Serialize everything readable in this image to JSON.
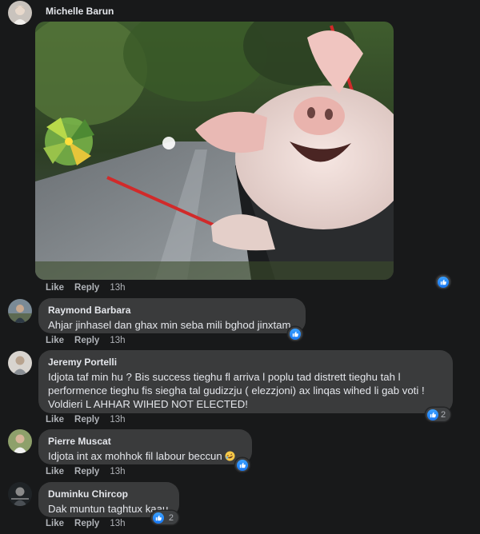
{
  "comments": [
    {
      "author": "Michelle Barun",
      "text": "",
      "actions": [
        "Like",
        "Reply"
      ],
      "time": "13h",
      "reactions": {
        "icons": [
          "like-icon"
        ],
        "count": ""
      }
    },
    {
      "author": "Raymond Barbara",
      "text": "Ahjar jinhasel dan ghax min seba mili bghod jinxtam",
      "actions": [
        "Like",
        "Reply"
      ],
      "time": "13h",
      "reactions": {
        "icons": [
          "like-icon"
        ],
        "count": ""
      }
    },
    {
      "author": "Jeremy Portelli",
      "text_lines": [
        "Idjota taf min hu ? Bis success tieghu fl arriva l poplu tad distrett tieghu tah l",
        "performence tieghu fis siegha tal gudizzju ( elezzjoni) ax linqas wihed li gab voti !",
        "Voldieri L AHHAR WIHED NOT ELECTED!"
      ],
      "actions": [
        "Like",
        "Reply"
      ],
      "time": "13h",
      "reactions": {
        "icons": [
          "like-icon"
        ],
        "count": "2"
      }
    },
    {
      "author": "Pierre Muscat",
      "text": "Idjota int ax mohhok fil labour beccun",
      "emoji": "rolling-laughing-emoji",
      "actions": [
        "Like",
        "Reply"
      ],
      "time": "13h",
      "reactions": {
        "icons": [
          "like-icon"
        ],
        "count": ""
      }
    },
    {
      "author": "Duminku Chircop",
      "text": "Dak muntun taghtux kaau",
      "actions": [
        "Like",
        "Reply"
      ],
      "time": "13h",
      "reactions": {
        "icons": [
          "like-icon",
          "haha-icon"
        ],
        "count": "2"
      }
    }
  ],
  "colors": {
    "background": "#18191a",
    "bubble": "#3a3b3c",
    "text": "#e4e6eb",
    "secondary_text": "#b0b3b8",
    "like_blue": "#1877f2"
  }
}
